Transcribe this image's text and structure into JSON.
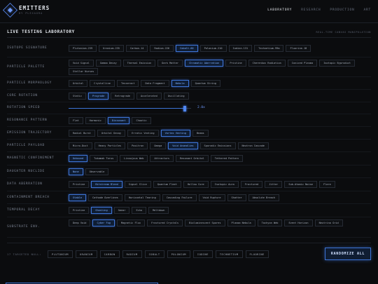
{
  "brand": {
    "name": "EMITTERS",
    "tagline": "BY PLEXAURA"
  },
  "nav": [
    {
      "label": "LABORATORY",
      "active": true
    },
    {
      "label": "RESEARCH",
      "active": false
    },
    {
      "label": "PRODUCTION",
      "active": false
    },
    {
      "label": "ART",
      "active": false
    }
  ],
  "page": {
    "title": "LIVE TESTING LABORATORY",
    "subtitle": "REAL-TIME CANVAS MANIPULATION"
  },
  "rows": [
    {
      "label": "ISOTOPE SIGNATURE",
      "options": [
        "Plutonium-239",
        "Uranium-235",
        "Carbon-14",
        "Radium-226",
        "Cobalt-60",
        "Polonium-210",
        "Iodine-131",
        "Technetium-99m",
        "Fluorine-18"
      ],
      "selected": [
        "Cobalt-60"
      ]
    },
    {
      "label": "PARTICLE PALETTE",
      "options": [
        "Void Signal",
        "Gamma Decay",
        "Thermal Emission",
        "Dark Matter",
        "Chromatic Aberration",
        "Pristine",
        "Cherenkov Radiation",
        "Ionized Plasma",
        "Isotopic Byproduct",
        "Stellar Nurses"
      ],
      "selected": [
        "Chromatic Aberration"
      ]
    },
    {
      "label": "PARTICLE MORPHOLOGY",
      "options": [
        "Orbital",
        "Crystalline",
        "Tesseract",
        "Data Fragment",
        "Nebula",
        "Quantum String"
      ],
      "selected": [
        "Nebula"
      ]
    },
    {
      "label": "CORE ROTATION",
      "options": [
        "Static",
        "Prograde",
        "Retrograde",
        "Accelerated",
        "Oscillating"
      ],
      "selected": [
        "Prograde"
      ]
    },
    {
      "label": "ROTATION SPEED",
      "type": "slider",
      "value": 0.95,
      "display": "2.0x"
    },
    {
      "label": "RESONANCE PATTERN",
      "options": [
        "Flat",
        "Harmonic",
        "Dissonant",
        "Chaotic"
      ],
      "selected": [
        "Dissonant"
      ]
    },
    {
      "label": "EMISSION TRAJECTORY",
      "options": [
        "Radial Burst",
        "Orbital Decay",
        "Erratic Venting",
        "Vortex Venting",
        "Beams"
      ],
      "selected": [
        "Vortex Venting"
      ]
    },
    {
      "label": "PARTICLE PAYLOAD",
      "options": [
        "Micro-Dust",
        "Heavy Particles",
        "Positron",
        "Omega",
        "Void Anomalies",
        "Sporadic Emissions",
        "Neutron Cascade"
      ],
      "selected": [
        "Void Anomalies"
      ]
    },
    {
      "label": "MAGNETIC CONFINEMENT",
      "options": [
        "Unbound",
        "Tokamak Torus",
        "Lissajous Web",
        "Attractors",
        "Resonant Orbital",
        "Tethered Pattern"
      ],
      "selected": [
        "Unbound"
      ]
    },
    {
      "label": "DAUGHTER NUCLIDE",
      "options": [
        "None",
        "Observable"
      ],
      "selected": [
        "None"
      ]
    },
    {
      "label": "DATA ABERRATION",
      "options": [
        "Pristine",
        "Bitstream Bleed",
        "Signal Slice",
        "Quantum Fleet",
        "Hollow Core",
        "Isotopic Aura",
        "Fractured",
        "Jitter",
        "Sub-Atomic Noise",
        "Flare"
      ],
      "selected": [
        "Bitstream Bleed"
      ]
    },
    {
      "label": "CONTAINMENT BREACH",
      "options": [
        "Stable",
        "Cathode Overlines",
        "Horizontal Tearing",
        "Cascading Failure",
        "Void Rupture",
        "Shatter",
        "Absolute Breach"
      ],
      "selected": [
        "Stable"
      ]
    },
    {
      "label": "TEMPORAL DECAY",
      "options": [
        "Pristine",
        "Ghosting",
        "Smear",
        "Echo",
        "Meltdown"
      ],
      "selected": [
        "Ghosting"
      ]
    },
    {
      "label": "SUBSTRATE ENV.",
      "options": [
        "Deep Void",
        "Cyber Fog",
        "Magnetic Flux",
        "Fractured Crystals",
        "Bioluminescent Spores",
        "Plasma Nebula",
        "Tachyon Web",
        "Event Horizon",
        "Neutrino Grid"
      ],
      "selected": [
        "Cyber Fog"
      ]
    }
  ],
  "footer": {
    "targets_label": "17 TARGETED NULL:",
    "chips": [
      "PLUTONIUM",
      "URANIUM",
      "CARBON",
      "RADIUM",
      "COBALT",
      "POLONIUM",
      "IODINE",
      "TECHNETIUM",
      "FLUORINE"
    ],
    "randomize_label": "RANDOMIZE ALL"
  },
  "colors": {
    "accent": "#3d74d6",
    "background": "#0b0c0e",
    "text": "#9aa3b2"
  }
}
